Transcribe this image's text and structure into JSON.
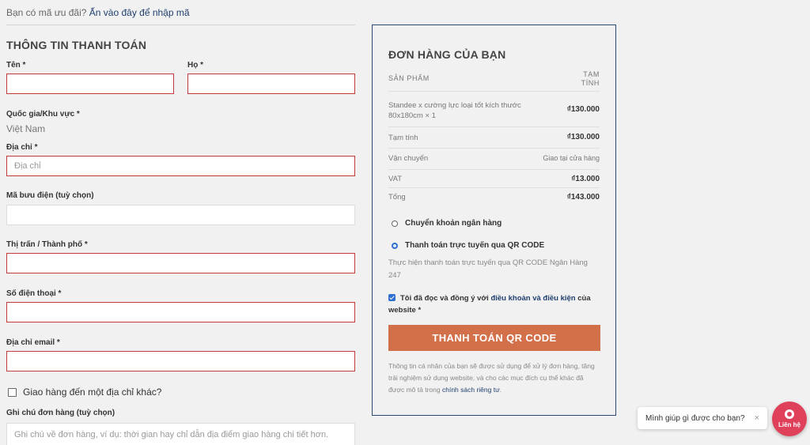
{
  "coupon": {
    "prefix": "Bạn có mã ưu đãi?",
    "link": "Ấn vào đây để nhập mã"
  },
  "billing": {
    "title": "THÔNG TIN THANH TOÁN",
    "first_name_label": "Tên *",
    "last_name_label": "Họ *",
    "country_label": "Quốc gia/Khu vực *",
    "country_value": "Việt Nam",
    "address_label": "Địa chỉ *",
    "address_placeholder": "Địa chỉ",
    "postcode_label": "Mã bưu điện (tuỳ chọn)",
    "city_label": "Thị trấn / Thành phố *",
    "phone_label": "Số điện thoại *",
    "email_label": "Địa chỉ email *",
    "ship_different": "Giao hàng đến một địa chỉ khác?",
    "notes_label": "Ghi chú đơn hàng (tuỳ chọn)",
    "notes_placeholder": "Ghi chú về đơn hàng, ví dụ: thời gian hay chỉ dẫn địa điểm giao hàng chi tiết hơn."
  },
  "order": {
    "title": "ĐƠN HÀNG CỦA BẠN",
    "col_product": "SẢN PHẨM",
    "col_subtotal_1": "TẠM",
    "col_subtotal_2": "TÍNH",
    "item_name_1": "Standee x cường lực loại tốt kích thước",
    "item_name_2": "80x180cm  × 1",
    "item_price": "₫130.000",
    "subtotal_label": "Tạm tính",
    "subtotal_value": "₫130.000",
    "shipping_label": "Vận chuyển",
    "shipping_value": "Giao tại cửa hàng",
    "vat_label": "VAT",
    "vat_value": "₫13.000",
    "total_label": "Tổng",
    "total_value": "₫143.000",
    "pay_bank": "Chuyển khoản ngân hàng",
    "pay_qr": "Thanh toán trực tuyến qua QR CODE",
    "pay_qr_desc": "Thực hiện thanh toán trực tuyến qua QR CODE Ngân Hàng 247",
    "terms_prefix": "Tôi đã đọc và đồng ý với",
    "terms_link": "điều khoản và điều kiện",
    "terms_suffix": "của website *",
    "pay_button": "THANH TOÁN QR CODE",
    "privacy_text": "Thông tin cá nhân của bạn sẽ được sử dụng để xử lý đơn hàng, tăng trải nghiệm sử dụng website, và cho các mục đích cụ thể khác đã được mô tả trong",
    "privacy_link": "chính sách riêng tư",
    "privacy_end": "."
  },
  "chat": {
    "bubble": "Mình giúp gì được cho bạn?",
    "close": "×",
    "button": "Liên hệ"
  },
  "colors": {
    "accent": "#d2704a",
    "border": "#2d4a73",
    "error": "#c33a3a",
    "chat": "#e0415a"
  }
}
